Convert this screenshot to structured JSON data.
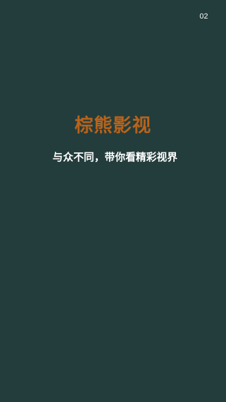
{
  "splash": {
    "countdown": "02",
    "app_name": "棕熊影视",
    "tagline": "与众不同，带你看精彩视界"
  },
  "colors": {
    "background": "#233d3c",
    "brand": "#b8631b",
    "text": "#ffffff"
  }
}
